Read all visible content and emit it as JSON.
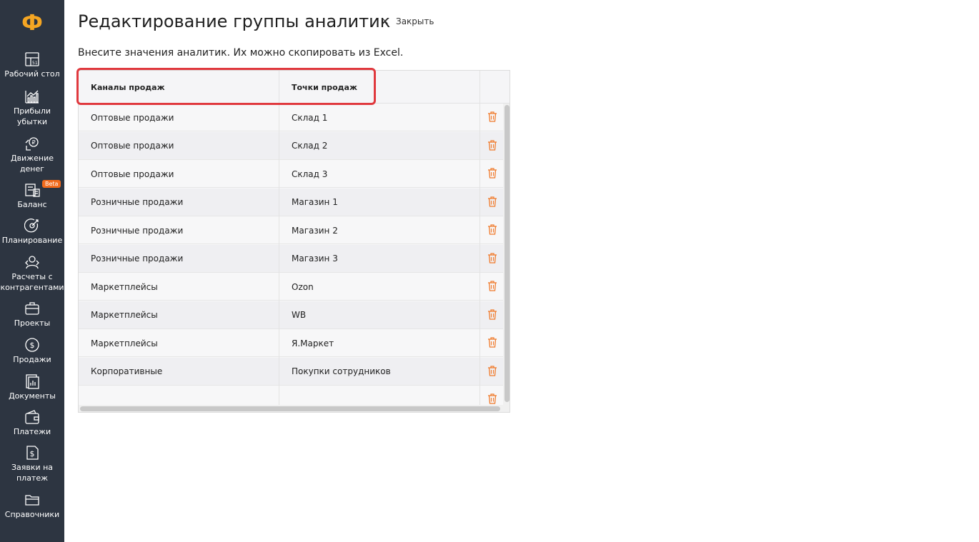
{
  "app": {
    "logo_glyph": "Ф",
    "accent_color": "#f5a623",
    "sidebar_bg": "#2d3541",
    "highlight_color": "#e0393e"
  },
  "sidebar": {
    "items": [
      {
        "label": "Рабочий стол",
        "icon": "dashboard-icon"
      },
      {
        "label": "Прибыли убытки",
        "icon": "chart-icon"
      },
      {
        "label": "Движение денег",
        "icon": "money-flow-icon"
      },
      {
        "label": "Баланс",
        "icon": "balance-icon",
        "badge": "Beta"
      },
      {
        "label": "Планирование",
        "icon": "target-icon"
      },
      {
        "label": "Расчеты с контрагентами",
        "icon": "contractors-icon"
      },
      {
        "label": "Проекты",
        "icon": "briefcase-icon"
      },
      {
        "label": "Продажи",
        "icon": "dollar-icon"
      },
      {
        "label": "Документы",
        "icon": "documents-icon"
      },
      {
        "label": "Платежи",
        "icon": "wallet-icon"
      },
      {
        "label": "Заявки на платеж",
        "icon": "payment-request-icon"
      },
      {
        "label": "Справочники",
        "icon": "folder-icon"
      }
    ]
  },
  "header": {
    "title": "Редактирование группы аналитик",
    "close_glyph": "×",
    "close_label": "Закрыть"
  },
  "subtitle": "Внесите значения аналитик. Их можно скопировать из Excel.",
  "table": {
    "columns": [
      "Каналы продаж",
      "Точки продаж"
    ],
    "rows": [
      [
        "Оптовые продажи",
        "Склад 1"
      ],
      [
        "Оптовые продажи",
        "Склад 2"
      ],
      [
        "Оптовые продажи",
        "Склад 3"
      ],
      [
        "Розничные продажи",
        "Магазин 1"
      ],
      [
        "Розничные продажи",
        "Магазин 2"
      ],
      [
        "Розничные продажи",
        "Магазин 3"
      ],
      [
        "Маркетплейсы",
        "Ozon"
      ],
      [
        "Маркетплейсы",
        "WB"
      ],
      [
        "Маркетплейсы",
        "Я.Маркет"
      ],
      [
        "Корпоративные",
        "Покупки сотрудников"
      ],
      [
        "",
        ""
      ]
    ],
    "delete_icon": "trash-icon",
    "delete_color": "#f07a2b"
  }
}
